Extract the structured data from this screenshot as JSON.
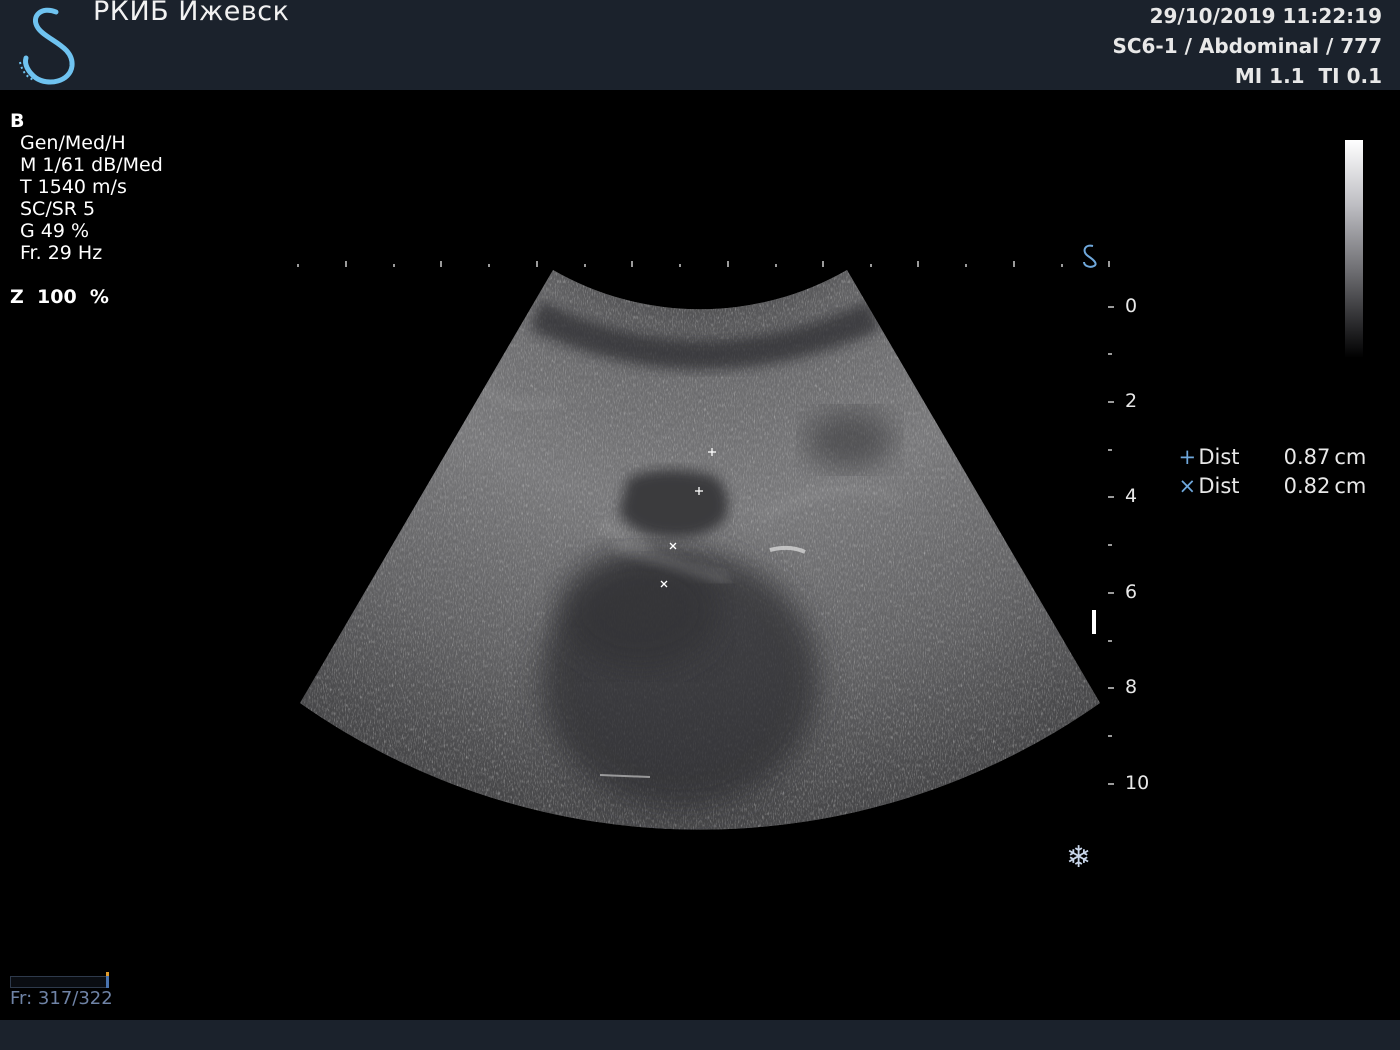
{
  "header": {
    "institution": "РКИБ Ижевск",
    "datetime": "29/10/2019 11:22:19",
    "probe_preset": "SC6-1 / Abdominal / 777",
    "indices": "MI 1.1  TI 0.1",
    "logo_icon": "swan-logo-icon"
  },
  "imaging_params": {
    "mode": "B",
    "lines": [
      "Gen/Med/H",
      "M 1/61 dB/Med",
      "T 1540 m/s",
      "SC/SR 5",
      "G 49 %",
      "Fr. 29 Hz"
    ],
    "zoom": "Z  100  %"
  },
  "depth_scale": {
    "labels": [
      "0",
      "2",
      "4",
      "6",
      "8",
      "10"
    ]
  },
  "measurements": [
    {
      "symbol": "+",
      "label": "Dist",
      "value": "0.87",
      "unit": "cm"
    },
    {
      "symbol": "×",
      "label": "Dist",
      "value": "0.82",
      "unit": "cm"
    }
  ],
  "status": {
    "freeze_icon": "snowflake-icon",
    "frame_counter": "Fr: 317/322"
  },
  "colors": {
    "accent": "#6fa8dc",
    "panel": "#1b222c"
  }
}
